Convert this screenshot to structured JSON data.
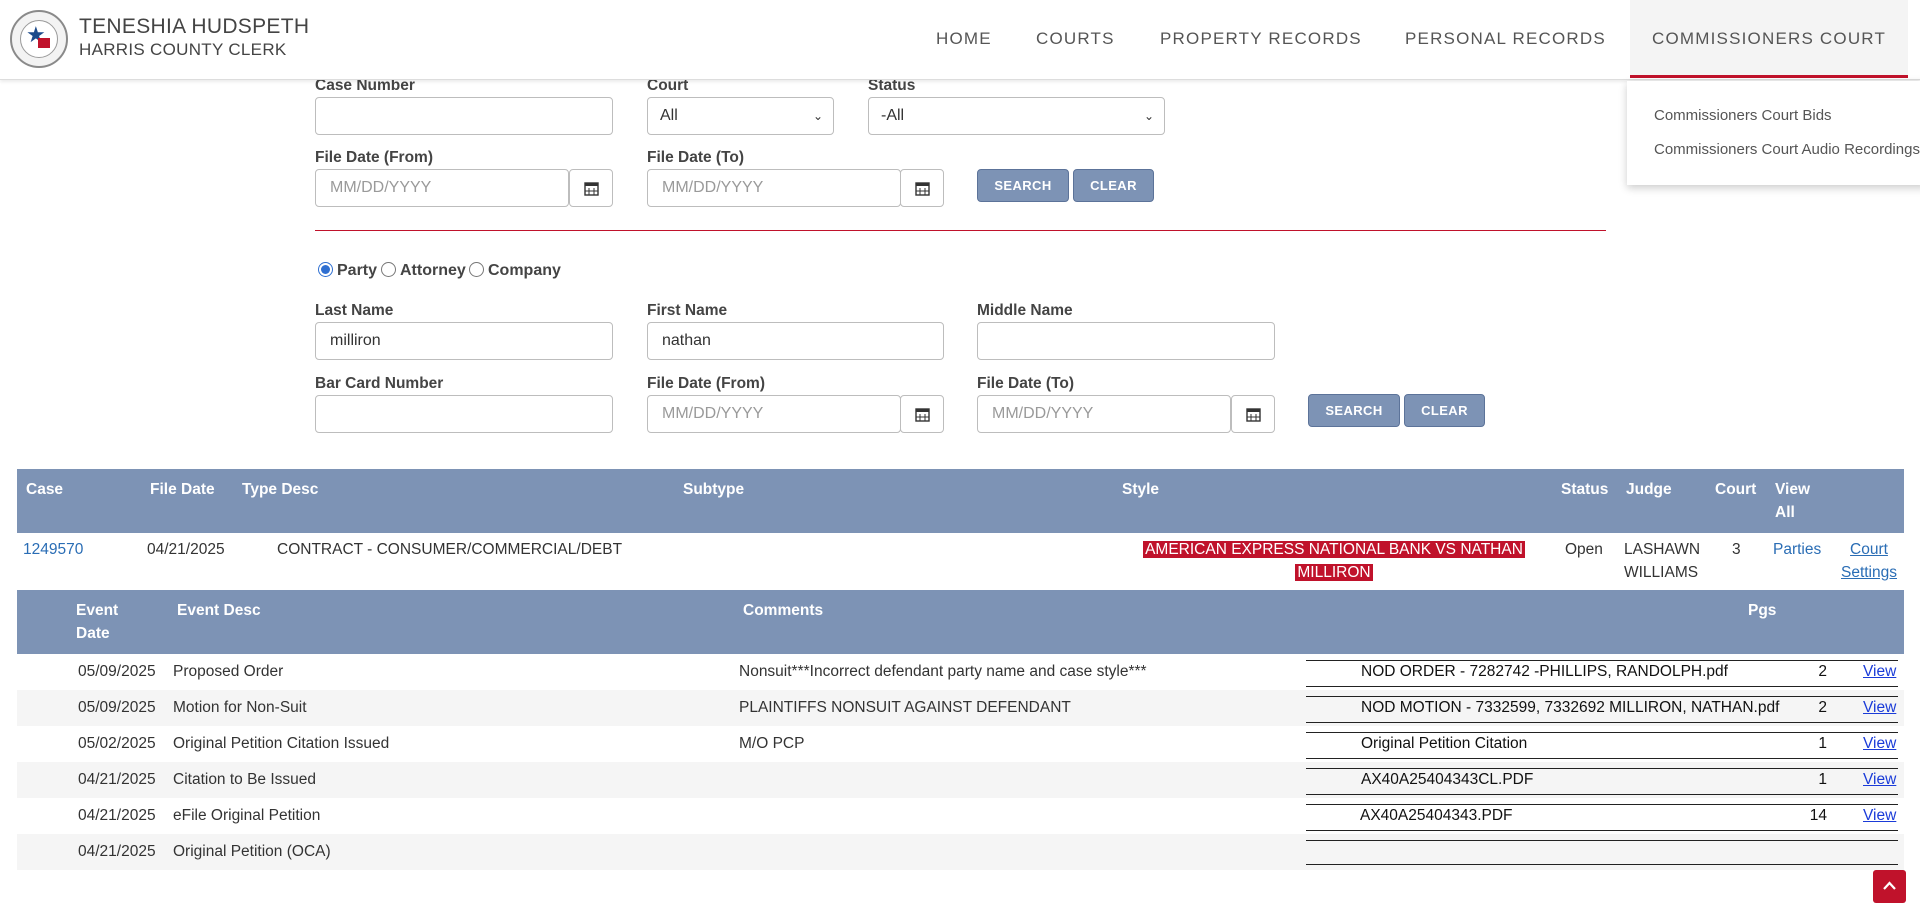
{
  "header": {
    "brand_name": "TENESHIA HUDSPETH",
    "brand_sub": "HARRIS COUNTY CLERK",
    "nav": [
      "HOME",
      "COURTS",
      "PROPERTY RECORDS",
      "PERSONAL RECORDS",
      "COMMISSIONERS COURT"
    ],
    "active_nav": "COMMISSIONERS COURT",
    "dropdown": [
      "Commissioners Court Bids",
      "Commissioners Court Audio Recordings"
    ]
  },
  "case_search": {
    "case_number_label": "Case Number",
    "case_number_value": "",
    "court_label": "Court",
    "court_value": "All",
    "status_label": "Status",
    "status_value": "-All",
    "file_date_from_label": "File Date (From)",
    "file_date_to_label": "File Date (To)",
    "date_placeholder": "MM/DD/YYYY",
    "search_label": "SEARCH",
    "clear_label": "CLEAR"
  },
  "party_search": {
    "radio_options": [
      "Party",
      "Attorney",
      "Company"
    ],
    "selected": "Party",
    "last_name_label": "Last Name",
    "last_name_value": "milliron",
    "first_name_label": "First Name",
    "first_name_value": "nathan",
    "middle_name_label": "Middle Name",
    "middle_name_value": "",
    "bar_card_label": "Bar Card Number",
    "bar_card_value": "",
    "file_date_from_label": "File Date (From)",
    "file_date_to_label": "File Date (To)",
    "date_placeholder": "MM/DD/YYYY",
    "search_label": "SEARCH",
    "clear_label": "CLEAR"
  },
  "results": {
    "columns": [
      "Case",
      "File Date",
      "Type Desc",
      "Subtype",
      "Style",
      "Status",
      "Judge",
      "Court",
      "View All"
    ],
    "row": {
      "case": "1249570",
      "file_date": "04/21/2025",
      "type_desc": "CONTRACT - CONSUMER/COMMERCIAL/DEBT",
      "subtype": "",
      "style_line1": "AMERICAN EXPRESS NATIONAL BANK VS NATHAN",
      "style_line2": "MILLIRON",
      "status": "Open",
      "judge": "LASHAWN WILLIAMS",
      "court": "3",
      "parties_link": "Parties",
      "court_settings_link": "Court Settings"
    }
  },
  "events": {
    "columns": [
      "Event Date",
      "Event Desc",
      "Comments",
      "Pgs"
    ],
    "view_label": "View",
    "rows": [
      {
        "date": "05/09/2025",
        "desc": "Proposed Order",
        "comment": "Nonsuit***Incorrect defendant party name and case style***",
        "doc": "NOD ORDER - 7282742 -PHILLIPS, RANDOLPH.pdf",
        "pgs": "2"
      },
      {
        "date": "05/09/2025",
        "desc": "Motion for Non-Suit",
        "comment": "PLAINTIFFS NONSUIT AGAINST DEFENDANT",
        "doc": "NOD MOTION - 7332599, 7332692 MILLIRON, NATHAN.pdf",
        "pgs": "2"
      },
      {
        "date": "05/02/2025",
        "desc": "Original Petition Citation Issued",
        "comment": "M/O PCP",
        "doc": "Original Petition Citation",
        "pgs": "1"
      },
      {
        "date": "04/21/2025",
        "desc": "Citation to Be Issued",
        "comment": "",
        "doc": "AX40A25404343CL.PDF",
        "pgs": "1"
      },
      {
        "date": "04/21/2025",
        "desc": "eFile Original Petition",
        "comment": "",
        "doc": "AX40A25404343.PDF",
        "pgs": "14"
      },
      {
        "date": "04/21/2025",
        "desc": "Original Petition (OCA)",
        "comment": "",
        "doc": "",
        "pgs": ""
      }
    ]
  },
  "colors": {
    "accent": "#c0122b",
    "table_header": "#7d93b5",
    "link": "#2a6db5"
  }
}
